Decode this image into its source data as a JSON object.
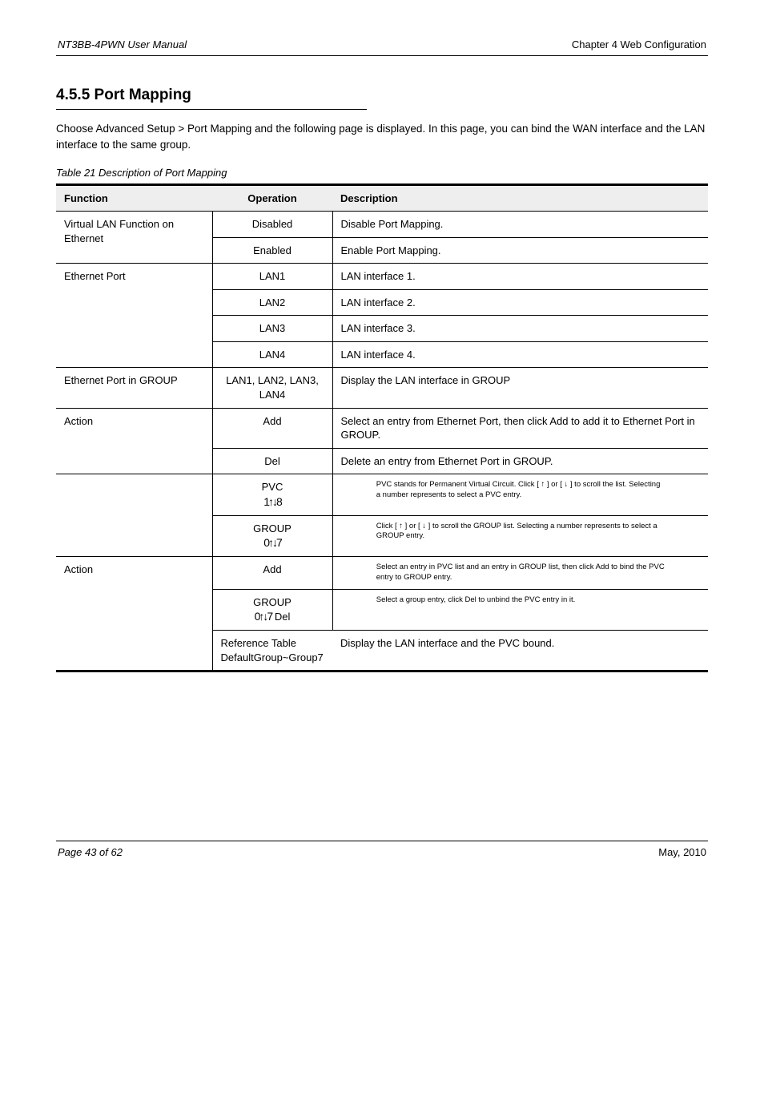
{
  "header": {
    "manual": "NT3BB-4PWN User Manual",
    "chapter": "Chapter 4 Web Configuration"
  },
  "section": {
    "title": "4.5.5 Port Mapping"
  },
  "intro": "Choose Advanced Setup > Port Mapping and the following page is displayed. In this page, you can bind the WAN interface and the LAN interface to the same group.",
  "table_caption": "Table 21 Description of Port Mapping",
  "table": {
    "headers": [
      "Function",
      "Operation",
      "Description"
    ],
    "groups": [
      {
        "fn": "Virtual LAN Function on Ethernet",
        "rows": [
          {
            "op": "Disabled",
            "desc": "Disable Port Mapping."
          },
          {
            "op": "Enabled",
            "desc": "Enable Port Mapping."
          }
        ],
        "sep": "med"
      },
      {
        "fn": "Ethernet Port",
        "rows": [
          {
            "op": "LAN1",
            "desc": "LAN interface 1."
          },
          {
            "op": "LAN2",
            "desc": "LAN interface 2."
          },
          {
            "op": "LAN3",
            "desc": "LAN interface 3."
          },
          {
            "op": "LAN4",
            "desc": "LAN interface 4."
          }
        ],
        "sep": "med"
      },
      {
        "fn": "Ethernet Port in GROUP",
        "rows": [
          {
            "op": "LAN1, LAN2, LAN3, LAN4",
            "desc": "Display the LAN interface in GROUP"
          }
        ],
        "sep": "med"
      },
      {
        "fn": "Action",
        "rows": [
          {
            "op": "Add",
            "desc": "Select an entry from Ethernet Port, then click Add to add it to Ethernet Port in GROUP."
          },
          {
            "op": "Del",
            "desc": "Delete an entry from Ethernet Port in GROUP."
          }
        ],
        "sep": "med"
      },
      {
        "fn": "",
        "rows": [
          {
            "op_arrows": "1↑↓8",
            "desc": "",
            "note": "PVC stands for Permanent Virtual Circuit. Click [ ↑ ] or [ ↓ ] to scroll the list. Selecting a number represents to select a PVC entry."
          },
          {
            "op_arrows": "0↑↓7",
            "desc": "",
            "note": "Click [ ↑ ] or [ ↓ ] to scroll the GROUP list. Selecting a number represents to select a GROUP entry."
          }
        ],
        "sep": "med"
      },
      {
        "fn": "Action",
        "rows": [
          {
            "op": "Add",
            "desc": "",
            "note": "Select an entry in PVC list and an entry in GROUP list, then click Add to bind the PVC entry to GROUP entry."
          },
          {
            "op_arrows": "0↑↓7",
            "op_suffix": "Del",
            "desc": "",
            "note": "Select a group entry, click Del to unbind the PVC entry in it."
          },
          {
            "op": "Reference Table DefaultGroup~Group7",
            "desc": "Display the LAN interface and the PVC bound."
          }
        ],
        "sep": "thick"
      }
    ]
  },
  "footer": {
    "left": "Page 43 of 62",
    "right": "May, 2010"
  }
}
